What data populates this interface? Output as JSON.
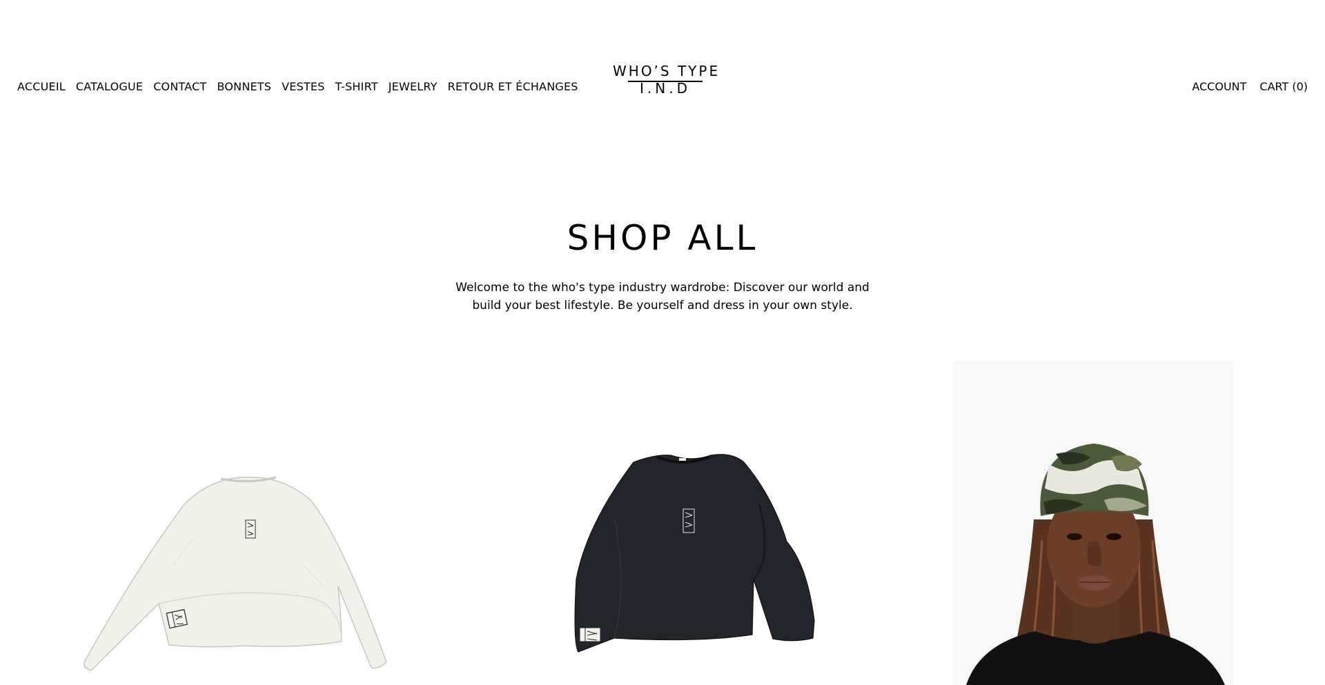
{
  "header": {
    "nav_left": [
      "ACCUEIL",
      "CATALOGUE",
      "CONTACT",
      "BONNETS",
      "VESTES",
      "T-SHIRT",
      "JEWELRY",
      "RETOUR ET ÉCHANGES"
    ],
    "logo_line1": "WHO’S TYPE",
    "logo_line2": "I.N.D",
    "account_label": "ACCOUNT",
    "cart_label": "CART (0)"
  },
  "hero": {
    "title": "SHOP ALL",
    "description": "Welcome to the who's type industry wardrobe: Discover our world and build your best lifestyle. Be yourself and dress in your own style."
  },
  "products": [
    {
      "image": "white-long-sleeve-shirt",
      "color": "#f2f2ec"
    },
    {
      "image": "black-long-sleeve-shirt",
      "color": "#22242a"
    },
    {
      "image": "model-camo-beanie",
      "color": "#f8f8f8"
    }
  ]
}
